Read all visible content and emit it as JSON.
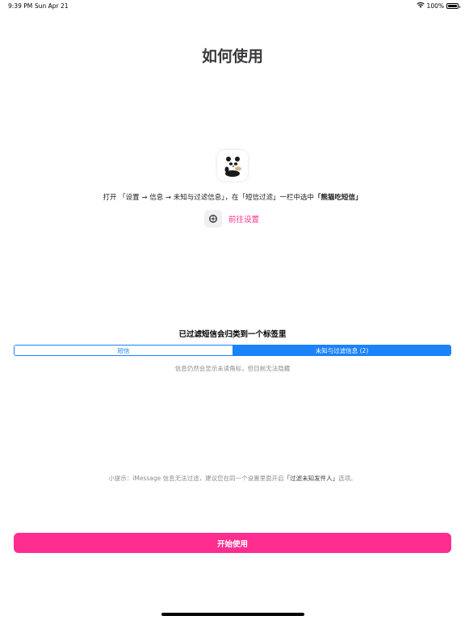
{
  "status_bar": {
    "time": "9:39 PM",
    "date": "Sun Apr 21",
    "battery": "100%",
    "battery_level": 1.0
  },
  "title": "如何使用",
  "instruction": {
    "prefix": "打开 「设置 → 信息 → 未知与过滤信息」，在「短信过滤」一栏中选中",
    "emphasis": "「熊猫吃短信」"
  },
  "settings_link": "前往设置",
  "section_heading": "已过滤短信会归类到一个标签里",
  "segmented": {
    "left": "短信",
    "right": "未知与过滤信息 (2)",
    "selected": "right"
  },
  "note": "信息仍然会显示未读角标，但目前无法隐藏",
  "tip": {
    "prefix": "小提示：iMessage 信息无法过滤，建议您在同一个设置里面开启",
    "emphasis": "「过滤未知发件人」",
    "suffix": "选项。"
  },
  "start_button": "开始使用",
  "colors": {
    "accent_pink": "#ff2d8f",
    "segment_blue": "#1a82fb",
    "secondary_text": "#8e8e93"
  },
  "icons": {
    "app": "panda-icon",
    "settings": "settings-gear-icon",
    "wifi": "wifi-icon",
    "battery": "battery-icon"
  }
}
